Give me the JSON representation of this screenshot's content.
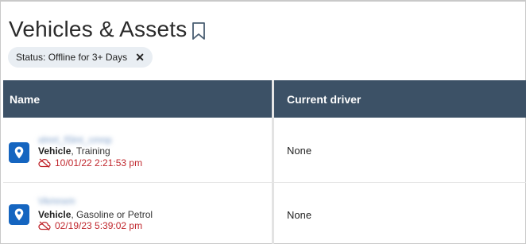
{
  "header": {
    "title": "Vehicles & Assets"
  },
  "filter_chip": {
    "label": "Status: Offline for 3+ Days",
    "remove_glyph": "✕"
  },
  "table": {
    "columns": [
      "Name",
      "Current driver"
    ],
    "rows": [
      {
        "name": "xlmrt_fSlnt_cmnp",
        "type_bold": "Vehicle",
        "type_rest": ", Training",
        "offline_since": "10/01/22 2:21:53 pm",
        "driver": "None"
      },
      {
        "name": "Vkmnxm",
        "type_bold": "Vehicle",
        "type_rest": ", Gasoline or Petrol",
        "offline_since": "02/19/23 5:39:02 pm",
        "driver": "None"
      }
    ]
  },
  "colors": {
    "header_bg": "#3c5166",
    "pin_bg": "#1565c0",
    "offline_red": "#c0272d",
    "chip_bg": "#e9eef3"
  },
  "icons": {
    "bookmark": "bookmark-icon",
    "location": "location-pin-icon",
    "offline": "cloud-off-icon"
  }
}
